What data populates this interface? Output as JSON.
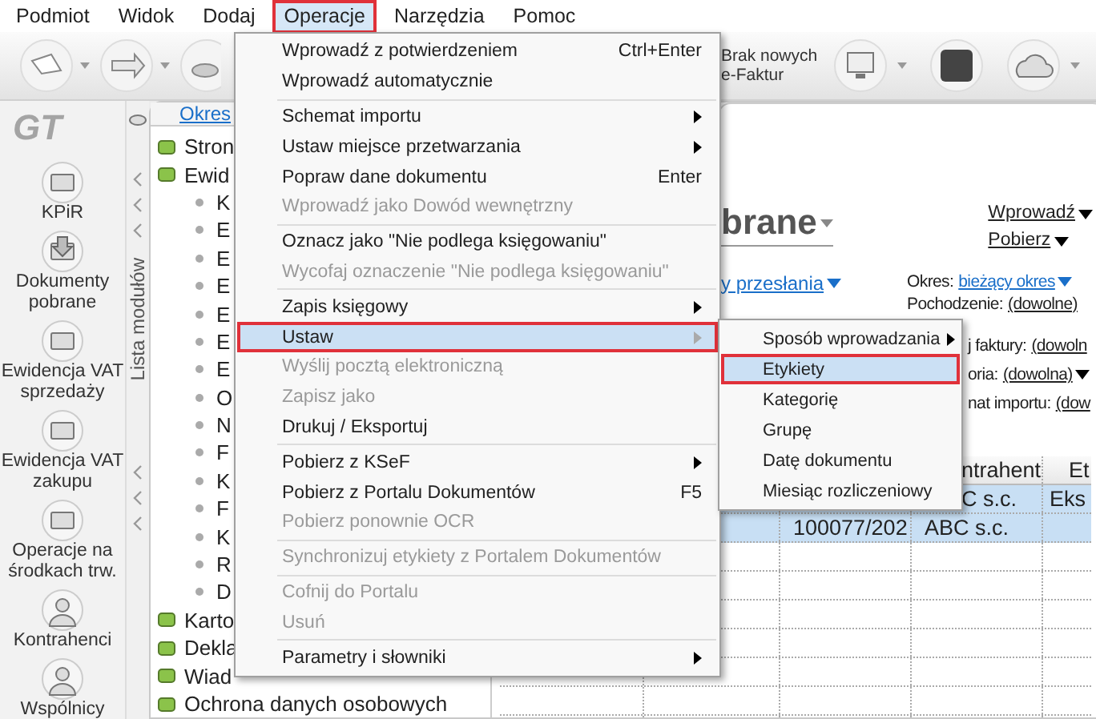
{
  "menubar": [
    {
      "label": "Podmiot",
      "selected": false
    },
    {
      "label": "Widok",
      "selected": false
    },
    {
      "label": "Dodaj",
      "selected": false
    },
    {
      "label": "Operacje",
      "selected": true
    },
    {
      "label": "Narzędzia",
      "selected": false
    },
    {
      "label": "Pomoc",
      "selected": false
    }
  ],
  "toolbar": {
    "status_text": "Brak nowych e-Faktur"
  },
  "sidebar": {
    "logo": "GT",
    "items": [
      {
        "label": "KPiR"
      },
      {
        "label": "Dokumenty pobrane"
      },
      {
        "label": "Ewidencja VAT sprzedaży"
      },
      {
        "label": "Ewidencja VAT zakupu"
      },
      {
        "label": "Operacje na środkach trw."
      },
      {
        "label": "Kontrahenci"
      },
      {
        "label": "Wspólnicy"
      }
    ]
  },
  "module_strip": {
    "label": "Lista modułów"
  },
  "tree": {
    "header_link": "Okres",
    "items": [
      {
        "label": "Stron"
      },
      {
        "label": "Ewid",
        "children": [
          {
            "label": "K"
          },
          {
            "label": "E"
          },
          {
            "label": "E"
          },
          {
            "label": "E"
          },
          {
            "label": "E"
          },
          {
            "label": "E"
          },
          {
            "label": "E"
          },
          {
            "label": "O"
          },
          {
            "label": "N"
          },
          {
            "label": "F"
          },
          {
            "label": "K"
          },
          {
            "label": "F"
          },
          {
            "label": "K"
          },
          {
            "label": "R"
          },
          {
            "label": "D"
          }
        ]
      },
      {
        "label": "Karto"
      },
      {
        "label": "Dekla"
      },
      {
        "label": "Wiad"
      },
      {
        "label": "Ochrona danych osobowych"
      }
    ]
  },
  "main": {
    "title": "brane",
    "actions": [
      "Wprowadź",
      "Pobierz"
    ],
    "filter_link": "y przesłania",
    "filters": [
      {
        "label": "Okres:",
        "value": "bieżący okres",
        "dropdown": true
      },
      {
        "label": "Pochodzenie:",
        "value": "(dowolne)"
      },
      {
        "label": "j faktury:",
        "value": "(dowoln"
      },
      {
        "label": "oria:",
        "value": "(dowolna)",
        "dropdown": true
      },
      {
        "label": "nat importu:",
        "value": "(dow"
      }
    ],
    "table": {
      "columns": {
        "column_4": "ntrahent",
        "column_5": "Et"
      },
      "rows": [
        {
          "selected": true,
          "cells": {
            "column_4": "C s.c.",
            "column_5": "Eks"
          }
        },
        {
          "selected": true,
          "cells": {
            "column_3": "100077/202",
            "column_4": "ABC s.c."
          }
        }
      ]
    }
  },
  "menu": {
    "items": [
      {
        "kind": "item",
        "label": "Wprowadź z potwierdzeniem",
        "shortcut": "Ctrl+Enter",
        "submenu": false,
        "disabled": false,
        "selected": false
      },
      {
        "kind": "item",
        "label": "Wprowadź automatycznie",
        "submenu": false,
        "disabled": false,
        "selected": false
      },
      {
        "kind": "separator"
      },
      {
        "kind": "item",
        "label": "Schemat importu",
        "submenu": true,
        "disabled": false,
        "selected": false
      },
      {
        "kind": "item",
        "label": "Ustaw miejsce przetwarzania",
        "submenu": true,
        "disabled": false,
        "selected": false
      },
      {
        "kind": "item",
        "label": "Popraw dane dokumentu",
        "shortcut": "Enter",
        "submenu": false,
        "disabled": false,
        "selected": false
      },
      {
        "kind": "item",
        "label": "Wprowadź jako Dowód wewnętrzny",
        "submenu": false,
        "disabled": true,
        "selected": false
      },
      {
        "kind": "separator"
      },
      {
        "kind": "item",
        "label": "Oznacz jako \"Nie podlega księgowaniu\"",
        "submenu": false,
        "disabled": false,
        "selected": false
      },
      {
        "kind": "item",
        "label": "Wycofaj oznaczenie \"Nie podlega księgowaniu\"",
        "submenu": false,
        "disabled": true,
        "selected": false
      },
      {
        "kind": "separator"
      },
      {
        "kind": "item",
        "label": "Zapis księgowy",
        "submenu": true,
        "disabled": false,
        "selected": false
      },
      {
        "kind": "item",
        "label": "Ustaw",
        "submenu": true,
        "disabled": false,
        "selected": true
      },
      {
        "kind": "item",
        "label": "Wyślij pocztą elektroniczną",
        "submenu": false,
        "disabled": true,
        "selected": false
      },
      {
        "kind": "item",
        "label": "Zapisz jako",
        "submenu": false,
        "disabled": true,
        "selected": false
      },
      {
        "kind": "item",
        "label": "Drukuj / Eksportuj",
        "submenu": false,
        "disabled": false,
        "selected": false
      },
      {
        "kind": "separator"
      },
      {
        "kind": "item",
        "label": "Pobierz z KSeF",
        "submenu": true,
        "disabled": false,
        "selected": false
      },
      {
        "kind": "item",
        "label": "Pobierz z Portalu Dokumentów",
        "shortcut": "F5",
        "submenu": false,
        "disabled": false,
        "selected": false
      },
      {
        "kind": "item",
        "label": "Pobierz ponownie OCR",
        "submenu": false,
        "disabled": true,
        "selected": false
      },
      {
        "kind": "separator"
      },
      {
        "kind": "item",
        "label": "Synchronizuj etykiety z Portalem Dokumentów",
        "submenu": false,
        "disabled": true,
        "selected": false
      },
      {
        "kind": "separator"
      },
      {
        "kind": "item",
        "label": "Cofnij do Portalu",
        "submenu": false,
        "disabled": true,
        "selected": false
      },
      {
        "kind": "item",
        "label": "Usuń",
        "submenu": false,
        "disabled": true,
        "selected": false
      },
      {
        "kind": "separator"
      },
      {
        "kind": "item",
        "label": "Parametry i słowniki",
        "submenu": true,
        "disabled": false,
        "selected": false
      }
    ]
  },
  "submenu": {
    "items": [
      {
        "label": "Sposób wprowadzania",
        "submenu": true,
        "selected": false
      },
      {
        "label": "Etykiety",
        "submenu": false,
        "selected": true
      },
      {
        "label": "Kategorię",
        "submenu": false,
        "selected": false
      },
      {
        "label": "Grupę",
        "submenu": false,
        "selected": false
      },
      {
        "label": "Datę dokumentu",
        "submenu": false,
        "selected": false
      },
      {
        "label": "Miesiąc rozliczeniowy",
        "submenu": false,
        "selected": false
      }
    ]
  }
}
